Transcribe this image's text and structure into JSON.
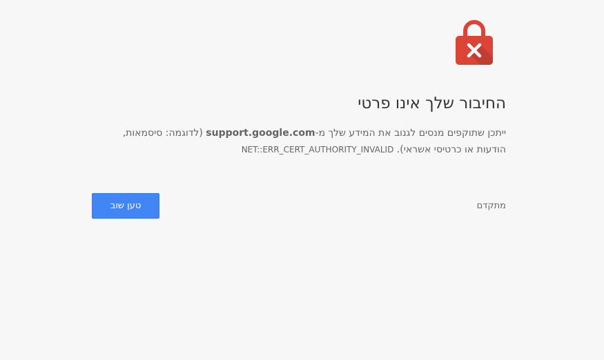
{
  "icon": {
    "name": "lock-error-icon",
    "body_color": "#db4437",
    "shackle_color": "#db4437",
    "shadow_color": "#b93a2f",
    "mark_color": "#ffffff"
  },
  "heading": "החיבור שלך אינו פרטי",
  "message": {
    "line1_prefix": "ייתכן שתוקפים מנסים לגנוב את המידע שלך מ-",
    "host": "support.google.com",
    "line1_suffix": " (לדוגמה: סיסמאות,",
    "line2": "הודעות או כרטיסי אשראי). ",
    "error_code": "NET::ERR_CERT_AUTHORITY_INVALID"
  },
  "actions": {
    "reload_label": "טען שוב",
    "advanced_label": "מתקדם"
  },
  "colors": {
    "background": "#f7f7f7",
    "primary_button": "#4285f4",
    "heading_text": "#333333",
    "body_text": "#646464"
  }
}
